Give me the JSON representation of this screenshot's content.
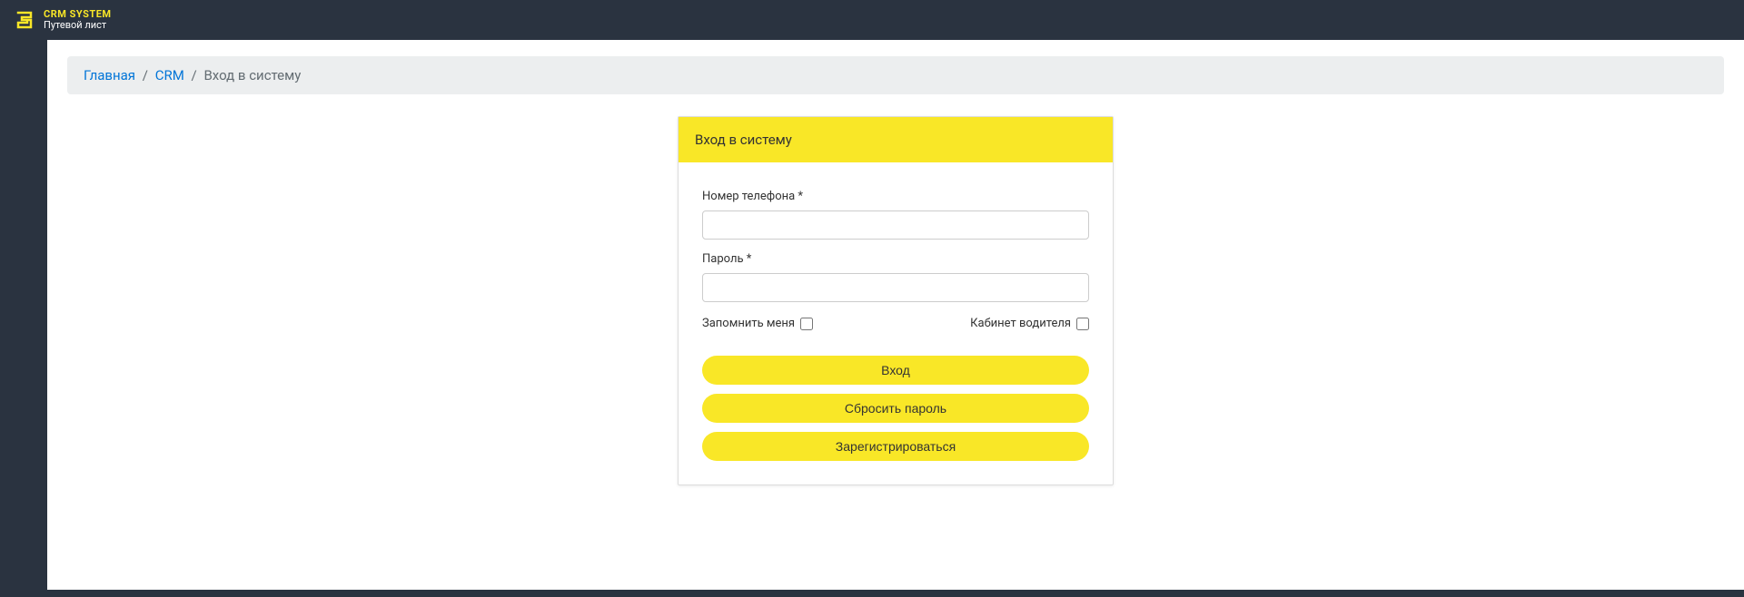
{
  "header": {
    "logo_title": "CRM SYSTEM",
    "logo_subtitle": "Путевой лист"
  },
  "breadcrumb": {
    "home": "Главная",
    "crm": "CRM",
    "current": "Вход в систему"
  },
  "login": {
    "title": "Вход в систему",
    "phone_label": "Номер телефона *",
    "password_label": "Пароль *",
    "remember_label": "Запомнить меня",
    "driver_label": "Кабинет водителя",
    "btn_login": "Вход",
    "btn_reset": "Сбросить пароль",
    "btn_register": "Зарегистрироваться"
  }
}
